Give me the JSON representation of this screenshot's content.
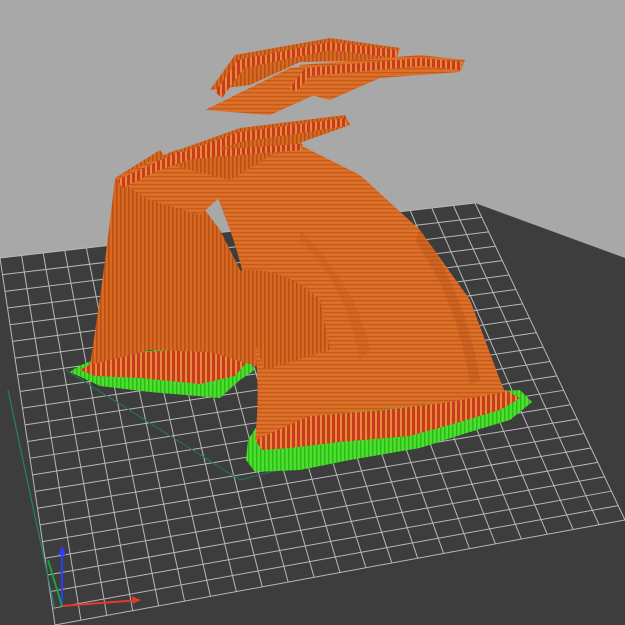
{
  "viewer": {
    "background": "#a8a8a8",
    "bed_color": "#3c3c3c",
    "grid_line_color": "#b4b4b4",
    "model_color": "#d96a1e",
    "model_shadow_color": "#b94a16",
    "perimeter_color": "#b42a1a",
    "skirt_color": "#44d62a",
    "bed_outline_color": "#2a6e5e",
    "axes": {
      "x_color": "#e53a2a",
      "y_color": "#1aa336",
      "z_color": "#2a3cff"
    },
    "icons": [
      "axis-x-icon",
      "axis-y-icon",
      "axis-z-icon"
    ]
  }
}
